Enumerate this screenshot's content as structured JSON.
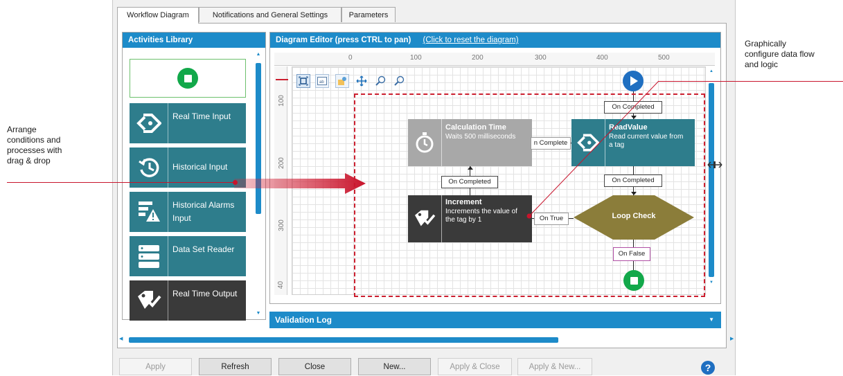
{
  "callouts": {
    "left": [
      "Arrange",
      "conditions and",
      "processes with",
      "drag & drop"
    ],
    "right": [
      "Graphically",
      "configure data flow",
      "and logic"
    ]
  },
  "tabs": [
    {
      "label": "Workflow Diagram",
      "active": true
    },
    {
      "label": "Notifications and General Settings",
      "active": false
    },
    {
      "label": "Parameters",
      "active": false
    }
  ],
  "library": {
    "title": "Activities Library",
    "items": [
      {
        "label": "Real Time Input",
        "icon": "tag-arrow-icon"
      },
      {
        "label": "Historical Input",
        "icon": "history-clock-icon"
      },
      {
        "label": "Historical Alarms Input",
        "icon": "alarm-list-icon"
      },
      {
        "label": "Data Set Reader",
        "icon": "database-icon"
      },
      {
        "label": "Real Time Output",
        "icon": "tag-check-icon"
      }
    ]
  },
  "diagram": {
    "title": "Diagram Editor (press CTRL to pan)",
    "reset_link": "(Click to reset the diagram)",
    "ruler_x": [
      "0",
      "100",
      "200",
      "300",
      "400",
      "500"
    ],
    "ruler_y": [
      "100",
      "200",
      "300",
      "40"
    ],
    "nodes": {
      "calc": {
        "title": "Calculation Time",
        "sub": "Waits 500 milliseconds"
      },
      "read": {
        "title": "ReadValue",
        "sub": "Read current value from a tag"
      },
      "inc": {
        "title": "Increment",
        "sub": "Increments the value of the tag by 1"
      },
      "loop": {
        "title": "Loop Check"
      }
    },
    "connectors": {
      "c1": "On Completed",
      "c2": "n Complete",
      "c3": "On Completed",
      "c4": "On Completed",
      "c5": "On True",
      "c6": "On False"
    },
    "colors": {
      "teal": "#2e7d8c",
      "dark": "#3a3a3a",
      "gray": "#a8a8a8",
      "olive": "#8b7d3a",
      "start": "#1f6fc1",
      "stop": "#12a84a",
      "selection": "#cc1f2f"
    }
  },
  "validation": {
    "title": "Validation Log"
  },
  "buttons": {
    "apply": "Apply",
    "refresh": "Refresh",
    "close": "Close",
    "new": "New...",
    "apply_close": "Apply & Close",
    "apply_new": "Apply & New..."
  }
}
